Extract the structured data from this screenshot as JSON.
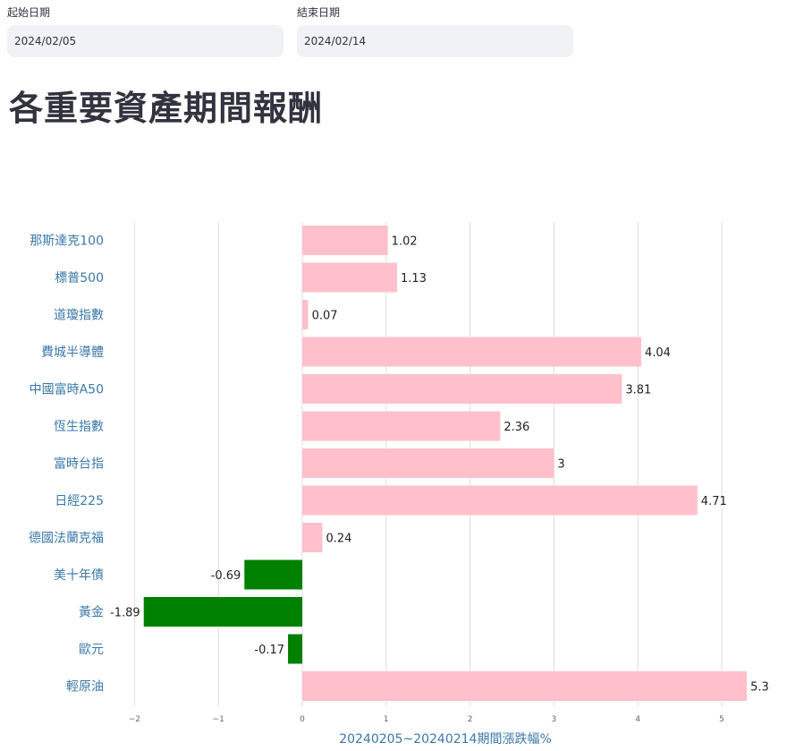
{
  "filters": {
    "start_label": "起始日期",
    "start_value": "2024/02/05",
    "end_label": "結束日期",
    "end_value": "2024/02/14"
  },
  "page_title": "各重要資產期間報酬",
  "colors": {
    "positive": "#ffc0cb",
    "negative": "#008000",
    "label_blue": "#3a79a8"
  },
  "chart_data": {
    "type": "bar",
    "orientation": "horizontal",
    "categories": [
      "那斯達克100",
      "標普500",
      "道瓊指數",
      "費城半導體",
      "中國富時A50",
      "恆生指數",
      "富時台指",
      "日經225",
      "德國法蘭克福",
      "美十年債",
      "黃金",
      "歐元",
      "輕原油"
    ],
    "values": [
      1.02,
      1.13,
      0.07,
      4.04,
      3.81,
      2.36,
      3,
      4.71,
      0.24,
      -0.69,
      -1.89,
      -0.17,
      5.3
    ],
    "value_labels": [
      "1.02",
      "1.13",
      "0.07",
      "4.04",
      "3.81",
      "2.36",
      "3",
      "4.71",
      "0.24",
      "-0.69",
      "-1.89",
      "-0.17",
      "5.3"
    ],
    "xlabel": "20240205~20240214期間漲跌幅%",
    "x_ticks": [
      "−2",
      "−1",
      "0",
      "1",
      "2",
      "3",
      "4",
      "5"
    ],
    "xlim": [
      -2.2,
      5.4
    ],
    "grid": true
  }
}
